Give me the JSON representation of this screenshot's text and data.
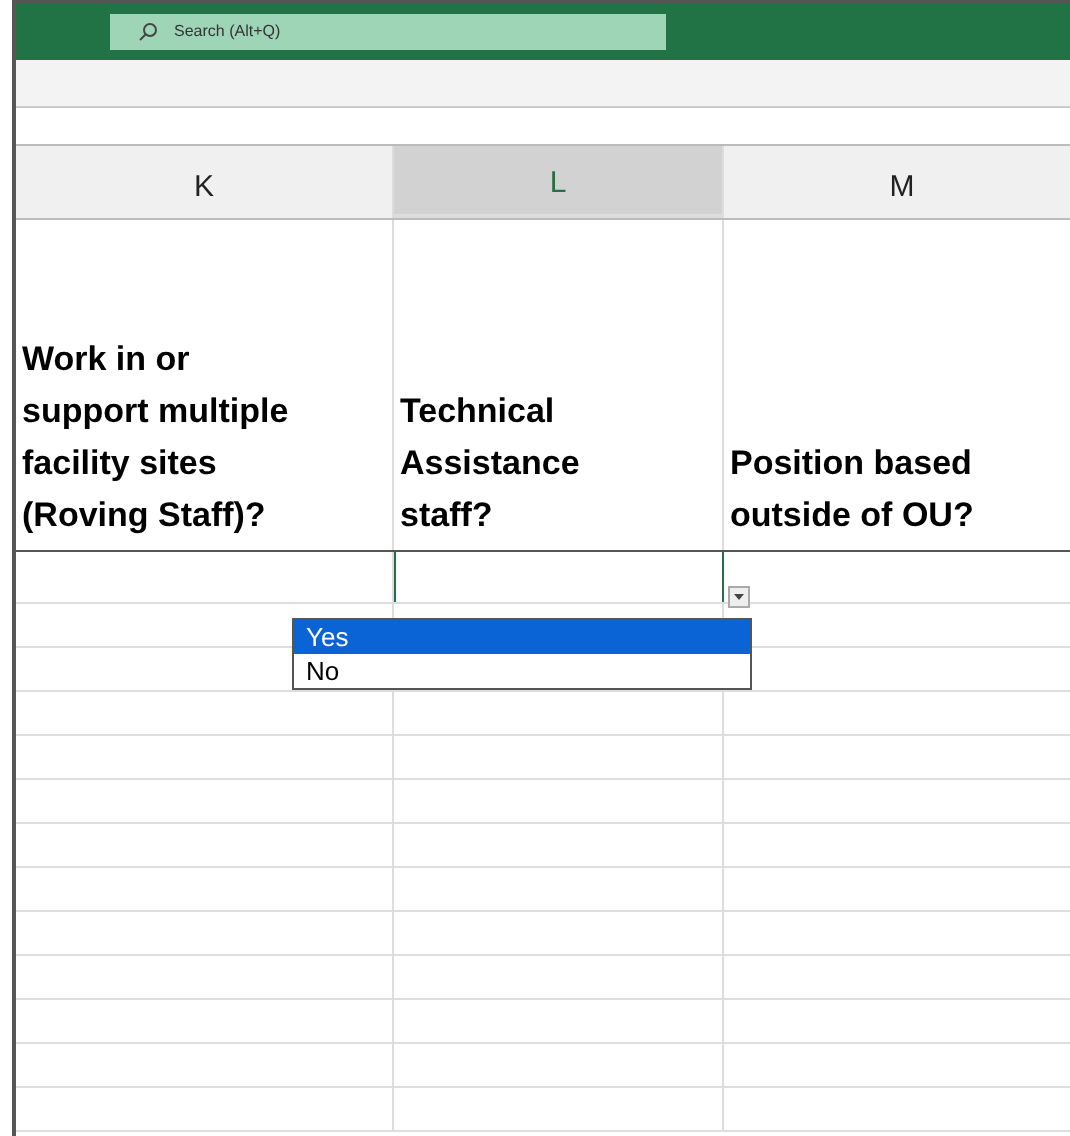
{
  "search": {
    "placeholder": "Search (Alt+Q)"
  },
  "columns": [
    {
      "letter": "K",
      "selected": false,
      "header": "Work in or\nsupport multiple\nfacility sites\n(Roving Staff)?"
    },
    {
      "letter": "L",
      "selected": true,
      "header": "Technical\nAssistance\nstaff?"
    },
    {
      "letter": "M",
      "selected": false,
      "header": "Position based\noutside of OU?"
    }
  ],
  "dropdown": {
    "options": [
      {
        "label": "Yes",
        "selected": true
      },
      {
        "label": "No",
        "selected": false
      }
    ]
  }
}
